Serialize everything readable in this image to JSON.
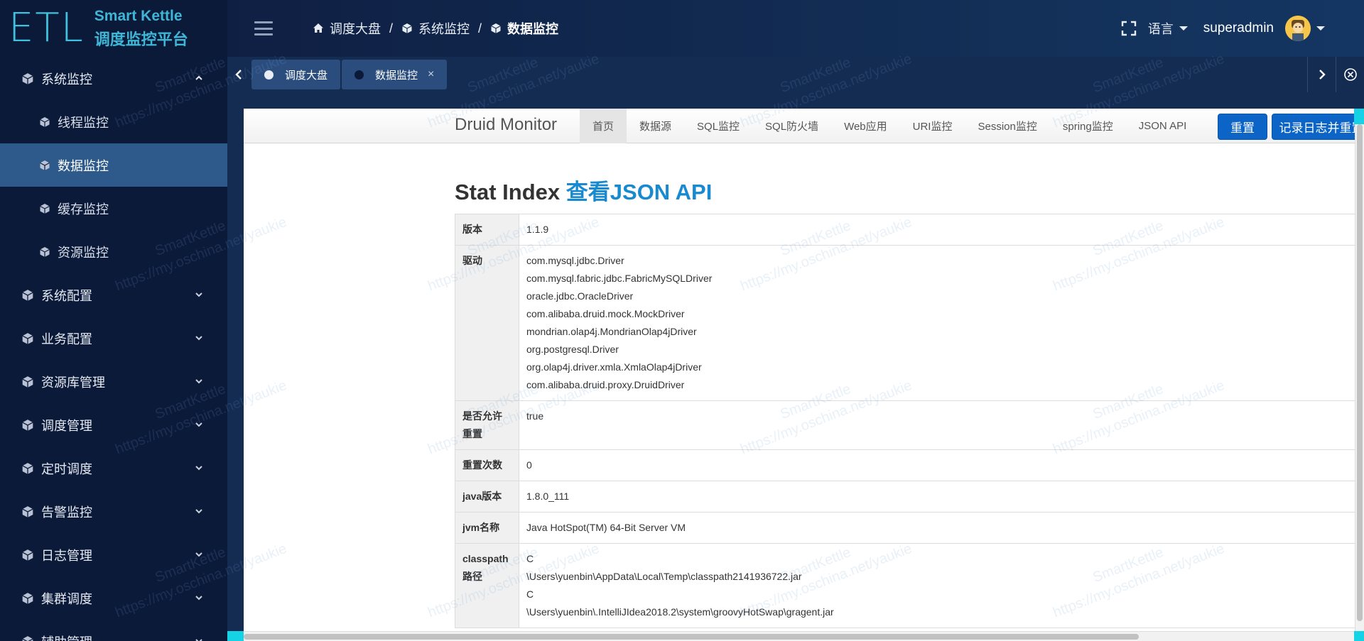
{
  "logo": {
    "mark": "ETL",
    "line1": "Smart Kettle",
    "line2": "调度监控平台"
  },
  "sidebar": {
    "items": [
      {
        "label": "系统监控",
        "expanded": true
      },
      {
        "label": "线程监控",
        "sub": true
      },
      {
        "label": "数据监控",
        "sub": true,
        "active": true
      },
      {
        "label": "缓存监控",
        "sub": true
      },
      {
        "label": "资源监控",
        "sub": true
      },
      {
        "label": "系统配置"
      },
      {
        "label": "业务配置"
      },
      {
        "label": "资源库管理"
      },
      {
        "label": "调度管理"
      },
      {
        "label": "定时调度"
      },
      {
        "label": "告警监控"
      },
      {
        "label": "日志管理"
      },
      {
        "label": "集群调度"
      },
      {
        "label": "辅助管理"
      }
    ]
  },
  "header": {
    "breadcrumb": [
      "调度大盘",
      "系统监控",
      "数据监控"
    ],
    "language": "语言",
    "username": "superadmin"
  },
  "tabs": [
    {
      "label": "调度大盘",
      "active": false
    },
    {
      "label": "数据监控",
      "active": true,
      "close": "×"
    }
  ],
  "druid": {
    "brand": "Druid Monitor",
    "nav": [
      "首页",
      "数据源",
      "SQL监控",
      "SQL防火墙",
      "Web应用",
      "URI监控",
      "Session监控",
      "spring监控",
      "JSON API"
    ],
    "reset_button": "重置",
    "log_reset_button": "记录日志并重置",
    "title": "Stat Index",
    "title_link": "查看JSON API",
    "rows": [
      {
        "key": "版本",
        "value": [
          "1.1.9"
        ]
      },
      {
        "key": "驱动",
        "value": [
          "com.mysql.jdbc.Driver",
          "com.mysql.fabric.jdbc.FabricMySQLDriver",
          "oracle.jdbc.OracleDriver",
          "com.alibaba.druid.mock.MockDriver",
          "mondrian.olap4j.MondrianOlap4jDriver",
          "org.postgresql.Driver",
          "org.olap4j.driver.xmla.XmlaOlap4jDriver",
          "com.alibaba.druid.proxy.DruidDriver"
        ]
      },
      {
        "key": "是否允许重置",
        "value": [
          "true"
        ]
      },
      {
        "key": "重置次数",
        "value": [
          "0"
        ]
      },
      {
        "key": "java版本",
        "value": [
          "1.8.0_111"
        ]
      },
      {
        "key": "jvm名称",
        "value": [
          "Java HotSpot(TM) 64-Bit Server VM"
        ]
      },
      {
        "key": "classpath路径",
        "value": [
          "C",
          "\\Users\\yuenbin\\AppData\\Local\\Temp\\classpath2141936722.jar",
          "C",
          "\\Users\\yuenbin\\.IntelliJIdea2018.2\\system\\groovyHotSwap\\gragent.jar"
        ]
      }
    ]
  },
  "watermark": {
    "line1": "SmartKettle",
    "line2": "https://my.oschina.net/yaukie"
  },
  "colors": {
    "sidebar_bg": "#0c1a3a",
    "active_menu": "#2d5a8a",
    "brand_cyan": "#3fb6d6",
    "primary_button": "#0b64c6",
    "link": "#1a8ad0",
    "accent": "#15d3e4"
  }
}
